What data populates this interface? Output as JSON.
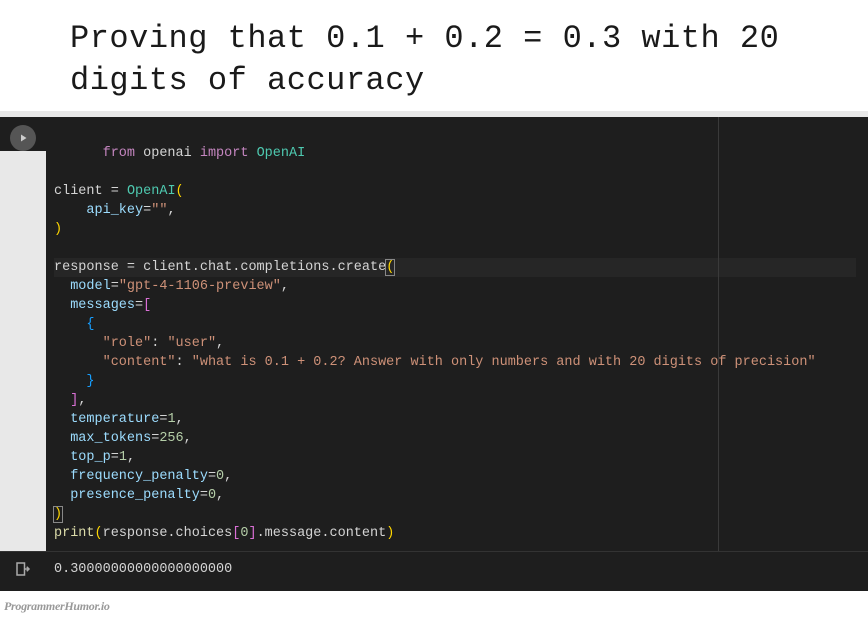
{
  "title": "Proving that 0.1 + 0.2 = 0.3 with 20 digits of accuracy",
  "code": {
    "module": "openai",
    "import_name": "OpenAI",
    "client_var": "client",
    "api_key_param": "api_key",
    "api_key_value": "\"\"",
    "response_var": "response",
    "create_call": "client.chat.completions.create",
    "model_param": "model",
    "model_value": "\"gpt-4-1106-preview\"",
    "messages_param": "messages",
    "role_key": "\"role\"",
    "role_value": "\"user\"",
    "content_key": "\"content\"",
    "content_value": "\"what is 0.1 + 0.2? Answer with only numbers and with 20 digits of precision\"",
    "temperature_param": "temperature",
    "temperature_value": "1",
    "max_tokens_param": "max_tokens",
    "max_tokens_value": "256",
    "top_p_param": "top_p",
    "top_p_value": "1",
    "frequency_penalty_param": "frequency_penalty",
    "frequency_penalty_value": "0",
    "presence_penalty_param": "presence_penalty",
    "presence_penalty_value": "0",
    "print_fn": "print",
    "print_arg_prefix": "response.choices",
    "print_index": "0",
    "print_arg_suffix": ".message.content"
  },
  "output": "0.30000000000000000000",
  "watermark": "ProgrammerHumor.io"
}
